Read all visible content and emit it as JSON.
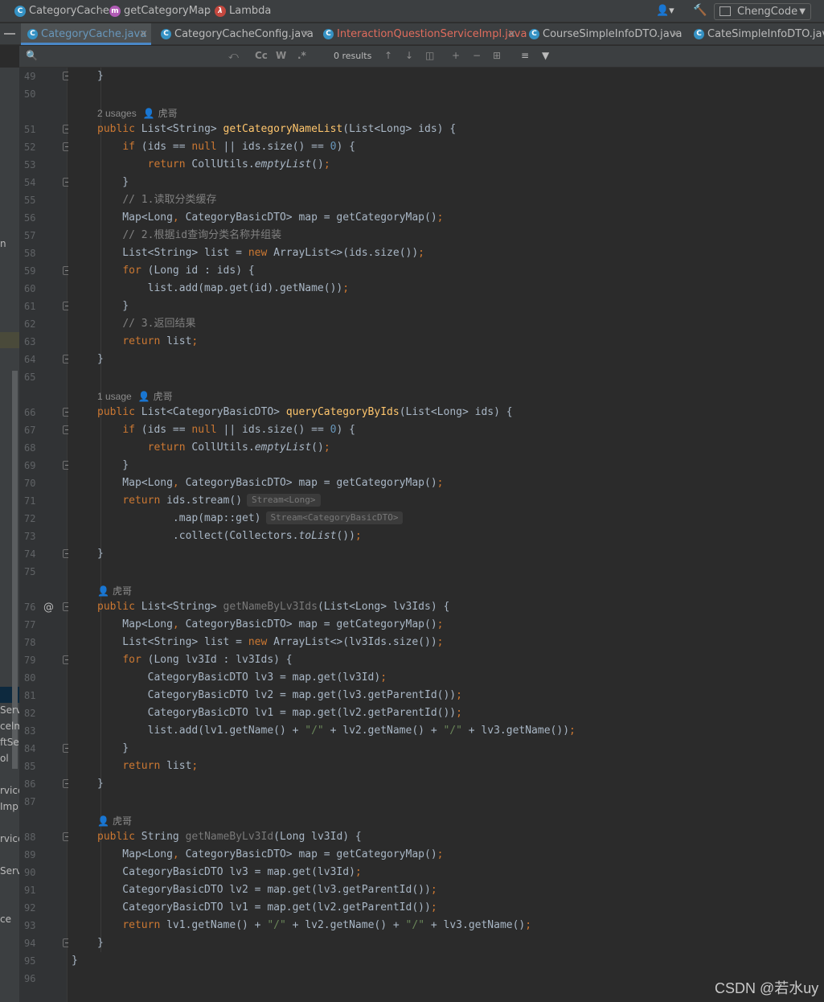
{
  "breadcrumb": {
    "items": [
      {
        "label": "CategoryCache",
        "icon": "class-icon",
        "icon_letter": "C"
      },
      {
        "label": "getCategoryMap",
        "icon": "method-icon",
        "icon_letter": "m"
      },
      {
        "label": "Lambda",
        "icon": "lambda-icon",
        "icon_letter": "λ"
      }
    ],
    "user_glyph": "👤▾",
    "hammer_glyph": "🔨",
    "run_config": "ChengCode",
    "dropdown_glyph": "▼"
  },
  "tabs": [
    {
      "label": "CategoryCache.java",
      "icon_letter": "C",
      "active": true,
      "error": false
    },
    {
      "label": "CategoryCacheConfig.java",
      "icon_letter": "C",
      "active": false,
      "error": false
    },
    {
      "label": "InteractionQuestionServiceImpl.java",
      "icon_letter": "C",
      "active": false,
      "error": true
    },
    {
      "label": "CourseSimpleInfoDTO.java",
      "icon_letter": "C",
      "active": false,
      "error": false
    },
    {
      "label": "CateSimpleInfoDTO.java",
      "icon_letter": "C",
      "active": false,
      "error": false
    }
  ],
  "tab_close_glyph": "×",
  "search": {
    "results": "0 results",
    "glyphs": {
      "search": "🔍",
      "replace": "⤺",
      "match_case": "Cc",
      "words": "W",
      "regex": ".*",
      "prev": "↑",
      "next": "↓",
      "select_all": "◫",
      "add_occurrence": "+",
      "remove_occurrence": "−",
      "filter_settings": "⊞",
      "align": "≡",
      "filter": "▼"
    }
  },
  "left_strip": {
    "fragments": [
      "n",
      "Serv",
      "celm",
      "ftSe",
      "ol",
      "rvice",
      "Impl",
      "rvice",
      "Servi",
      "ce"
    ]
  },
  "gutter": {
    "line_numbers": [
      "49",
      "50",
      "51",
      "52",
      "53",
      "54",
      "55",
      "56",
      "57",
      "58",
      "59",
      "60",
      "61",
      "62",
      "63",
      "64",
      "65",
      "66",
      "67",
      "68",
      "69",
      "70",
      "71",
      "72",
      "73",
      "74",
      "75",
      "76",
      "77",
      "78",
      "79",
      "80",
      "81",
      "82",
      "83",
      "84",
      "85",
      "86",
      "87",
      "88",
      "89",
      "90",
      "91",
      "92",
      "93",
      "94",
      "95",
      "96"
    ],
    "override_marker": "@"
  },
  "hints": [
    {
      "usage": "2 usages",
      "author": "虎哥"
    },
    {
      "usage": "1 usage",
      "author": "虎哥"
    },
    {
      "usage": "",
      "author": "虎哥"
    },
    {
      "usage": "",
      "author": "虎哥"
    }
  ],
  "code": {
    "type_hint_stream_long": "Stream<Long>",
    "type_hint_stream_dto": "Stream<CategoryBasicDTO>"
  },
  "watermark": "CSDN @若水uy"
}
